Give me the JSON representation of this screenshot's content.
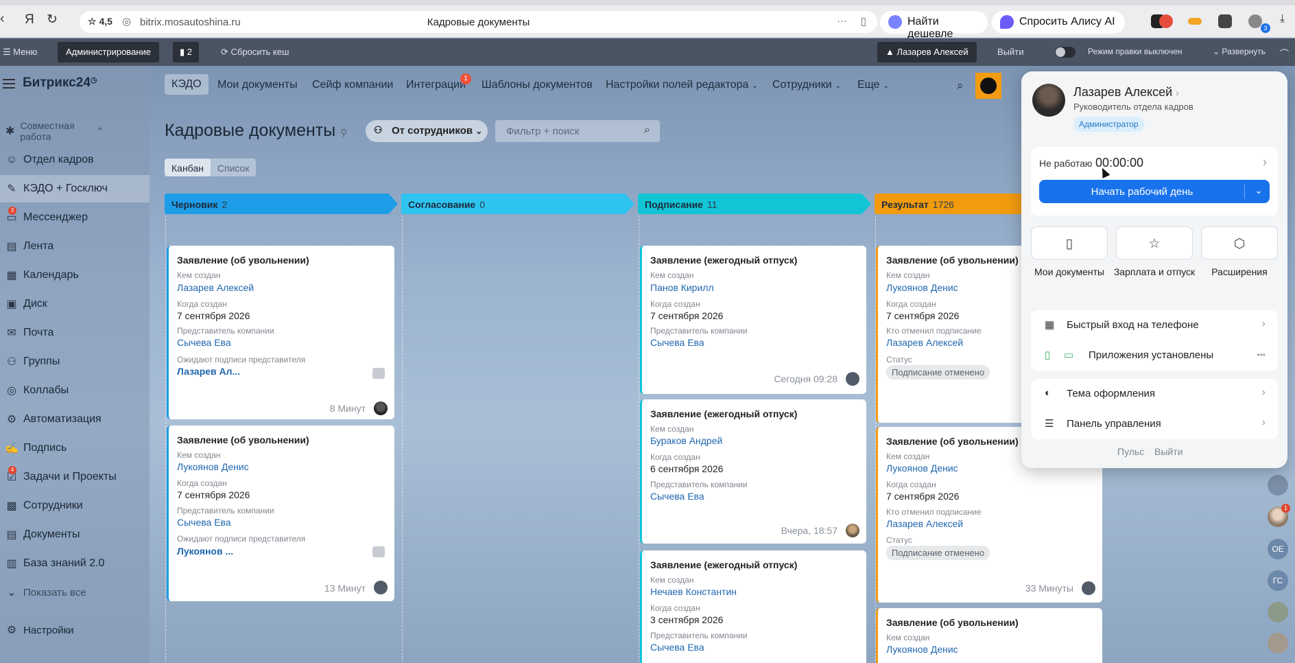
{
  "browser": {
    "rating": "4,5",
    "url": "bitrix.mosautoshina.ru",
    "page_title": "Кадровые документы",
    "find_cheaper": "Найти дешевле",
    "ask_alice": "Спросить Алису AI",
    "ext_badge": "3"
  },
  "adminbar": {
    "menu": "Меню",
    "admin": "Администрирование",
    "notif_count": "2",
    "clear_cache": "Сбросить кеш",
    "user": "Лазарев Алексей",
    "logout": "Выйти",
    "edit_mode": "Режим правки",
    "edit_state": "выключен",
    "expand": "Развернуть"
  },
  "portal": {
    "logo": "Битрикс24",
    "nav": [
      {
        "label": "КЭДО",
        "active": true
      },
      {
        "label": "Мои документы"
      },
      {
        "label": "Сейф компании"
      },
      {
        "label": "Интеграции",
        "badge": "1"
      },
      {
        "label": "Шаблоны документов"
      },
      {
        "label": "Настройки полей редактора"
      },
      {
        "label": "Сотрудники"
      },
      {
        "label": "Еще"
      }
    ]
  },
  "sidebar": {
    "section": "Совместная работа",
    "items": [
      {
        "label": "Отдел кадров"
      },
      {
        "label": "КЭДО + Госключ"
      },
      {
        "label": "Мессенджер",
        "badge": "3"
      },
      {
        "label": "Лента"
      },
      {
        "label": "Календарь"
      },
      {
        "label": "Диск"
      },
      {
        "label": "Почта"
      },
      {
        "label": "Группы"
      },
      {
        "label": "Коллабы"
      },
      {
        "label": "Автоматизация"
      },
      {
        "label": "Подпись"
      },
      {
        "label": "Задачи и Проекты",
        "badge": "4"
      },
      {
        "label": "Сотрудники"
      },
      {
        "label": "Документы"
      },
      {
        "label": "База знаний 2.0"
      }
    ],
    "show_all": "Показать все",
    "settings": "Настройки"
  },
  "page": {
    "title": "Кадровые документы",
    "from_employees": "От сотрудников",
    "filter_placeholder": "Фильтр + поиск",
    "view_kanban": "Канбан",
    "view_list": "Список"
  },
  "columns": [
    {
      "name": "Черновик",
      "count": "2",
      "color": "#1e9de8"
    },
    {
      "name": "Согласование",
      "count": "0",
      "color": "#2ec4f0"
    },
    {
      "name": "Подписание",
      "count": "11",
      "color": "#11c5d6"
    },
    {
      "name": "Результат",
      "count": "1726",
      "color": "#f29b0f"
    }
  ],
  "labels": {
    "created_by": "Кем создан",
    "created_when": "Когда создан",
    "company_rep": "Представитель компании",
    "await_rep": "Ожидают подписи представителя",
    "cancelled_by": "Кто отменил подписание",
    "status": "Статус"
  },
  "cards": {
    "c1": {
      "title": "Заявление (об увольнении)",
      "author": "Лазарев Алексей",
      "date": "7 сентября 2026",
      "rep": "Сычева Ева",
      "await": "Лазарев Ал...",
      "time": "8 Минут"
    },
    "c2": {
      "title": "Заявление (об увольнении)",
      "author": "Лукоянов Денис",
      "date": "7 сентября 2026",
      "rep": "Сычева Ева",
      "await": "Лукоянов ...",
      "time": "13 Минут"
    },
    "s1": {
      "title": "Заявление (ежегодный отпуск)",
      "author": "Панов Кирилл",
      "date": "7 сентября 2026",
      "rep": "Сычева Ева",
      "time": "Сегодня 09:28"
    },
    "s2": {
      "title": "Заявление (ежегодный отпуск)",
      "author": "Бураков Андрей",
      "date": "6 сентября 2026",
      "rep": "Сычева Ева",
      "time": "Вчера, 18:57"
    },
    "s3": {
      "title": "Заявление (ежегодный отпуск)",
      "author": "Нечаев Константин",
      "date": "3 сентября 2026",
      "rep": "Сычева Ева"
    },
    "r1": {
      "title": "Заявление (об увольнении)",
      "author": "Лукоянов Денис",
      "date": "7 сентября 2026",
      "cancelled": "Лазарев Алексей",
      "status": "Подписание отменено"
    },
    "r2": {
      "title": "Заявление (об увольнении)",
      "author": "Лукоянов Денис",
      "date": "7 сентября 2026",
      "cancelled": "Лазарев Алексей",
      "status": "Подписание отменено",
      "time": "33 Минуты"
    },
    "r3": {
      "title": "Заявление (об увольнении)",
      "author": "Лукоянов Денис"
    }
  },
  "right_strip": [
    "ОЕ",
    "ГС"
  ],
  "right_strip_badge": "1",
  "popup": {
    "name": "Лазарев Алексей",
    "position": "Руководитель отдела кадров",
    "role": "Администратор",
    "work_status": "Не работаю",
    "timer": "00:00:00",
    "start_day": "Начать рабочий день",
    "quick": [
      {
        "label": "Мои документы",
        "icon": "document-icon"
      },
      {
        "label": "Зарплата и отпуск",
        "icon": "star-icon"
      },
      {
        "label": "Расширения",
        "icon": "box-icon"
      }
    ],
    "phone_login": "Быстрый вход на телефоне",
    "apps_installed": "Приложения установлены",
    "theme": "Тема оформления",
    "control_panel": "Панель управления",
    "pulse": "Пульс",
    "logout": "Выйти"
  }
}
